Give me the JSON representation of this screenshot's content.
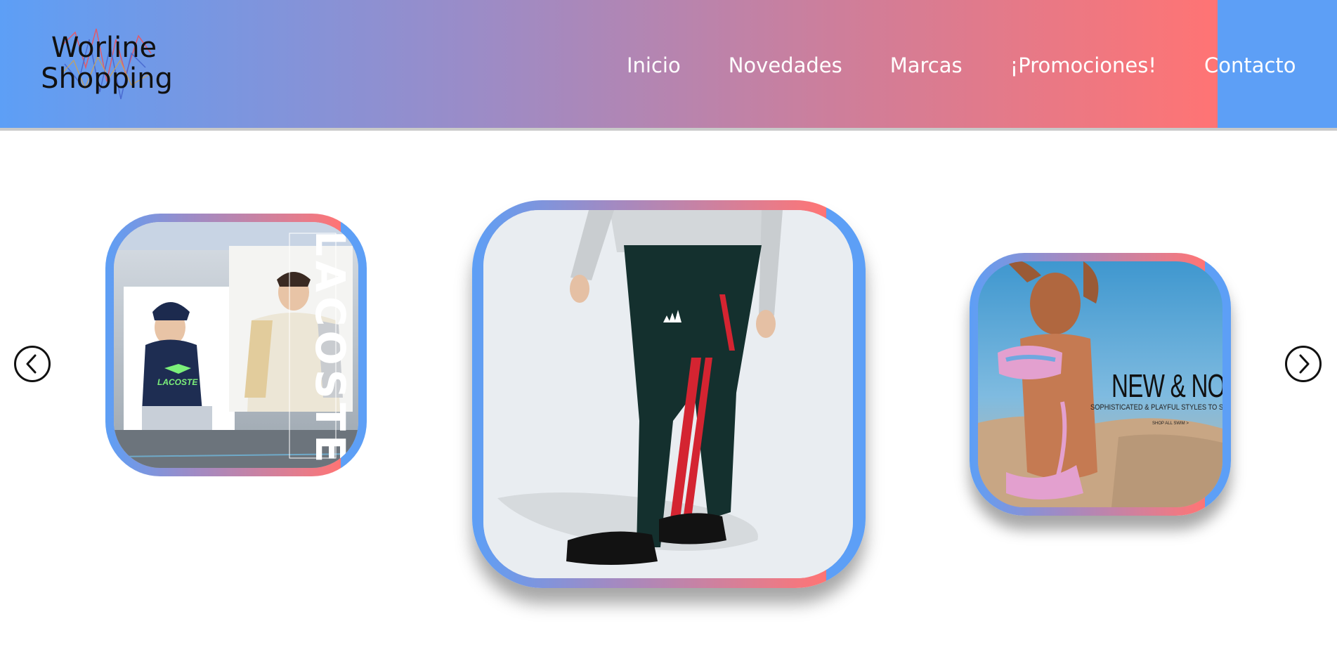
{
  "brand": {
    "logo_line1": "Worline",
    "logo_line2": "Shopping"
  },
  "nav": {
    "items": [
      "Inicio",
      "Novedades",
      "Marcas",
      "¡Promociones!",
      "Contacto"
    ]
  },
  "carousel": {
    "prev_icon": "chevron-left-icon",
    "next_icon": "chevron-right-icon",
    "slides": [
      {
        "name": "lacoste",
        "text": "LACOSTE",
        "shirt_text": "LACOSTE"
      },
      {
        "name": "adidas-pants"
      },
      {
        "name": "swimwear",
        "title": "NEW & NOW",
        "subtitle": "SOPHISTICATED & PLAYFUL STYLES TO SUIT ANY M",
        "cta": "SHOP ALL SWIM >"
      }
    ]
  },
  "colors": {
    "gradient_start": "#5d9ff6",
    "gradient_mid": "#a18ac3",
    "gradient_end": "#ff7474"
  }
}
